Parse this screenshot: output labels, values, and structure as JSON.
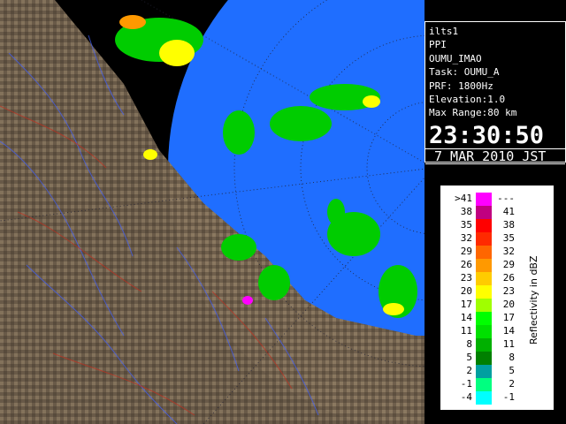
{
  "info": {
    "line1": "ilts1",
    "line2": "PPI",
    "line3": "OUMU_IMAO",
    "line4": "Task: OUMU_A",
    "line5": "PRF: 1800Hz",
    "line6": "Elevation:1.0",
    "line7": "Max Range:80 km",
    "time": "23:30:50",
    "date": "7 MAR 2010 JST"
  },
  "legend": {
    "unit": "Reflectivity in dBZ",
    "rows": [
      {
        "low": ">41",
        "high": "---",
        "color": "#ff00ff"
      },
      {
        "low": "38",
        "high": "41",
        "color": "#c00080"
      },
      {
        "low": "35",
        "high": "38",
        "color": "#ff0000"
      },
      {
        "low": "32",
        "high": "35",
        "color": "#ff2a00"
      },
      {
        "low": "29",
        "high": "32",
        "color": "#ff6600"
      },
      {
        "low": "26",
        "high": "29",
        "color": "#ff9900"
      },
      {
        "low": "23",
        "high": "26",
        "color": "#ffcc00"
      },
      {
        "low": "20",
        "high": "23",
        "color": "#ffff00"
      },
      {
        "low": "17",
        "high": "20",
        "color": "#a0ff00"
      },
      {
        "low": "14",
        "high": "17",
        "color": "#00ff00"
      },
      {
        "low": "11",
        "high": "14",
        "color": "#00e000"
      },
      {
        "low": "8",
        "high": "11",
        "color": "#00b000"
      },
      {
        "low": "5",
        "high": "8",
        "color": "#008000"
      },
      {
        "low": "2",
        "high": "5",
        "color": "#00a0a0"
      },
      {
        "low": "-1",
        "high": "2",
        "color": "#00ff80"
      },
      {
        "low": "-4",
        "high": "-1",
        "color": "#00ffff"
      }
    ]
  },
  "colors": {
    "sea": "#1f6eff",
    "land": "#7a6a55",
    "background": "#000000"
  }
}
